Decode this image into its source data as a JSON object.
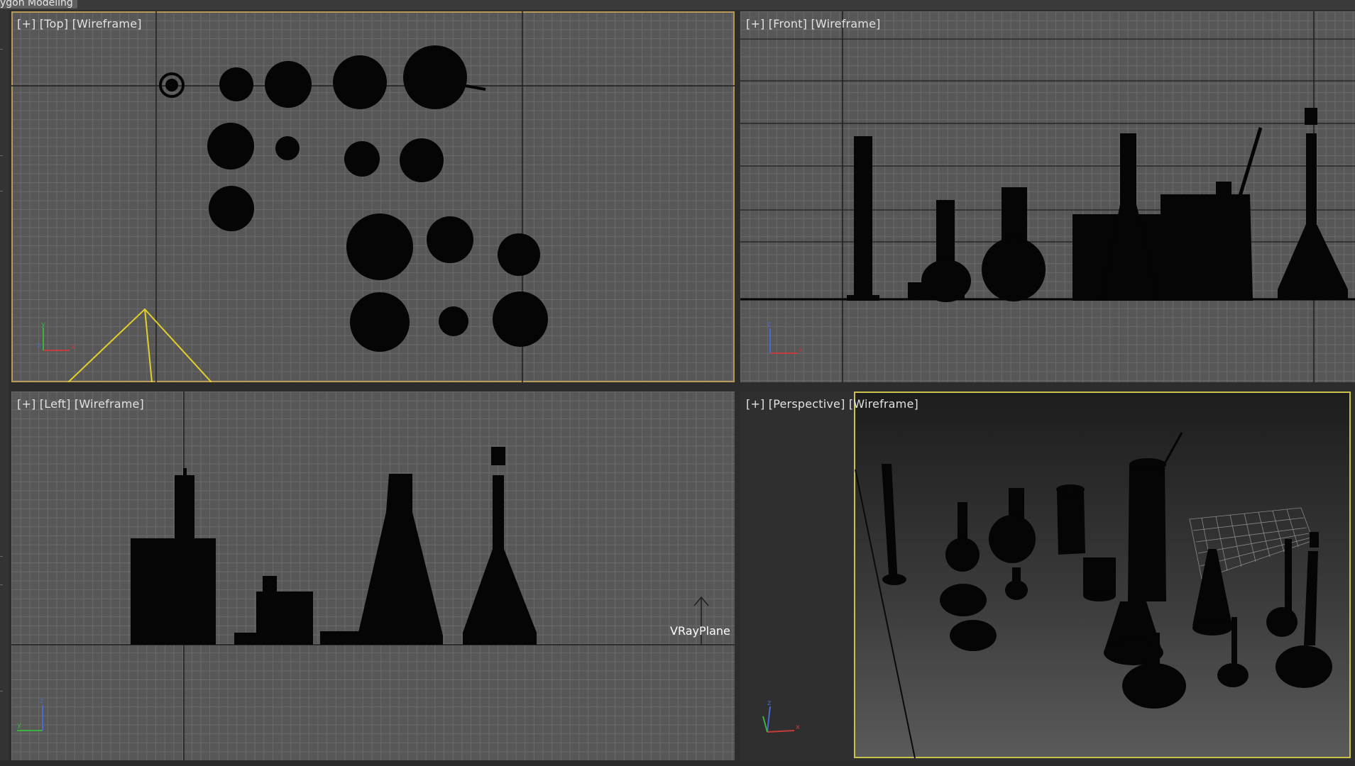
{
  "ribbon": {
    "tab_label": "ygon Modeling"
  },
  "viewports": {
    "top": {
      "plus": "[+]",
      "view": "[Top]",
      "mode": "[Wireframe]"
    },
    "front": {
      "plus": "[+]",
      "view": "[Front]",
      "mode": "[Wireframe]"
    },
    "left": {
      "plus": "[+]",
      "view": "[Left]",
      "mode": "[Wireframe]",
      "object_label": "VRayPlane"
    },
    "perspective": {
      "plus": "[+]",
      "view": "[Perspective]",
      "mode": "[Wireframe]"
    }
  },
  "axis_gizmo": {
    "x": "x",
    "y": "y",
    "z": "z"
  },
  "colors": {
    "viewport_bg": "#575757",
    "grid_line": "#6a6a6a",
    "active_border": "#b79a5a",
    "selected_frame": "#c9c24a",
    "camera_cone": "#e2cf2a",
    "object_fill": "#050505"
  }
}
